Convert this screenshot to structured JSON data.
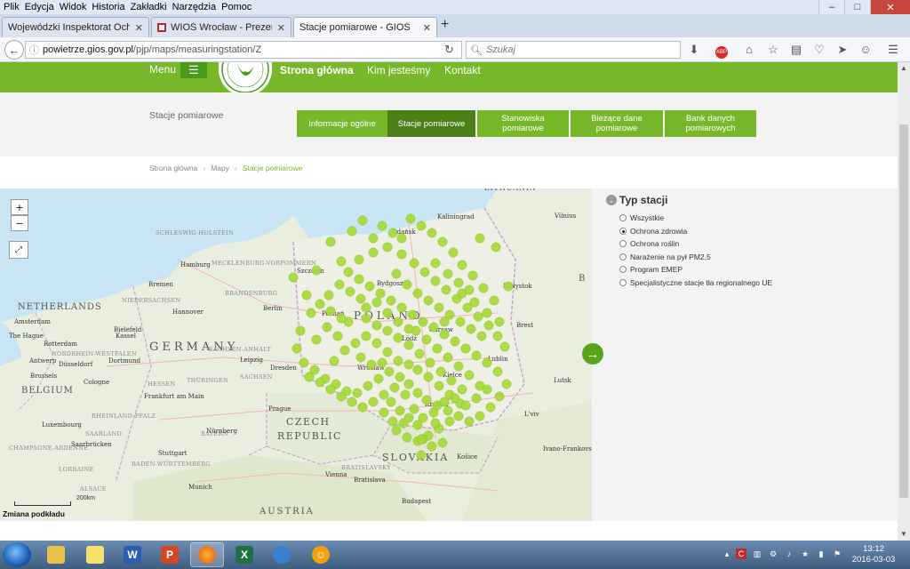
{
  "menubar": {
    "items": [
      "Plik",
      "Edycja",
      "Widok",
      "Historia",
      "Zakładki",
      "Narzędzia",
      "Pomoc"
    ]
  },
  "tabs": [
    {
      "label": "Wojewódzki Inspektorat Ochro...",
      "active": false
    },
    {
      "label": "WIOŚ Wrocław - Prezentac...",
      "active": false
    },
    {
      "label": "Stacje pomiarowe - GIOŚ",
      "active": true
    }
  ],
  "newtab": "+",
  "url": {
    "host": "powietrze.gios.gov.pl",
    "path": "/pjp/maps/measuringstation/Z"
  },
  "search": {
    "placeholder": "Szukaj"
  },
  "site": {
    "menu_label": "Menu",
    "nav": [
      "Strona główna",
      "Kim jesteśmy",
      "Kontakt"
    ],
    "section_title": "Stacje pomiarowe",
    "subtabs": [
      {
        "label": "Informacje ogólne",
        "active": false
      },
      {
        "label": "Stacje pomiarowe",
        "active": true
      },
      {
        "label": "Stanowiska pomiarowe",
        "active": false
      },
      {
        "label": "Bieżące dane pomiarowe",
        "active": false
      },
      {
        "label": "Bank danych pomiarowych",
        "active": false
      }
    ],
    "breadcrumb": [
      "Strona główna",
      "Mapy",
      "Stacje pomiarowe"
    ]
  },
  "map": {
    "zoom_in": "+",
    "zoom_out": "−",
    "basemap_switch": "Zmiana podkładu",
    "scale_label": "200km",
    "station_color": "#a6d93a",
    "labels": {
      "countries": [
        "POLAND",
        "GERMANY",
        "CZECH",
        "REPUBLIC",
        "SLOVAKIA",
        "AUSTRIA",
        "NETHERLANDS",
        "BELGIUM",
        "LITHUANIA",
        "B"
      ],
      "regions": [
        "SCHLESWIG-HOLSTEIN",
        "MECKLENBURG-VORPOMMERN",
        "BRANDENBURG",
        "NIEDERSACHSEN",
        "SACHSEN-ANHALT",
        "THÜRINGEN",
        "SACHSEN",
        "HESSEN",
        "RHEINLAND-PFALZ",
        "SAARLAND",
        "BADEN-WÜRTTEMBERG",
        "BAYERN",
        "NORDRHEIN-WESTFALEN",
        "CHAMPAGNE-ARDENNE",
        "LORRAINE",
        "ALSACE",
        "BRATISLAVSKÝ"
      ],
      "cities": [
        "Hamburg",
        "Bremen",
        "Hannover",
        "Berlin",
        "Leipzig",
        "Dresden",
        "Frankfurt am Main",
        "Nürnberg",
        "Stuttgart",
        "Munich",
        "Amsterdam",
        "Rotterdam",
        "Brussels",
        "Antwerp",
        "Cologne",
        "Düsseldorf",
        "Dortmund",
        "Bielefeld",
        "Luxembourg",
        "Szczecin",
        "Gdańsk",
        "Kaliningrad",
        "Vilnius",
        "Bydgoszcz",
        "Poznań",
        "Warsaw",
        "Łódź",
        "Wrocław",
        "Kraków",
        "Lublin",
        "Białystok",
        "Brest",
        "Lutsk",
        "L'viv",
        "Ivano-Frankovsk",
        "Vienna",
        "Bratislava",
        "Budapest",
        "Košice",
        "Kielce",
        "Prague",
        "The Hague",
        "Saarbrücken",
        "Kassel"
      ]
    }
  },
  "panel": {
    "title": "Typ stacji",
    "options": [
      {
        "label": "Wszystkie",
        "selected": false
      },
      {
        "label": "Ochrona zdrowia",
        "selected": true
      },
      {
        "label": "Ochrona roślin",
        "selected": false
      },
      {
        "label": "Narażenie na pył PM2,5",
        "selected": false
      },
      {
        "label": "Program EMEP",
        "selected": false
      },
      {
        "label": "Specjalistyczne stacje tła regionalnego UE",
        "selected": false
      }
    ]
  },
  "taskbar": {
    "time": "13:12",
    "date": "2016-03-03"
  }
}
